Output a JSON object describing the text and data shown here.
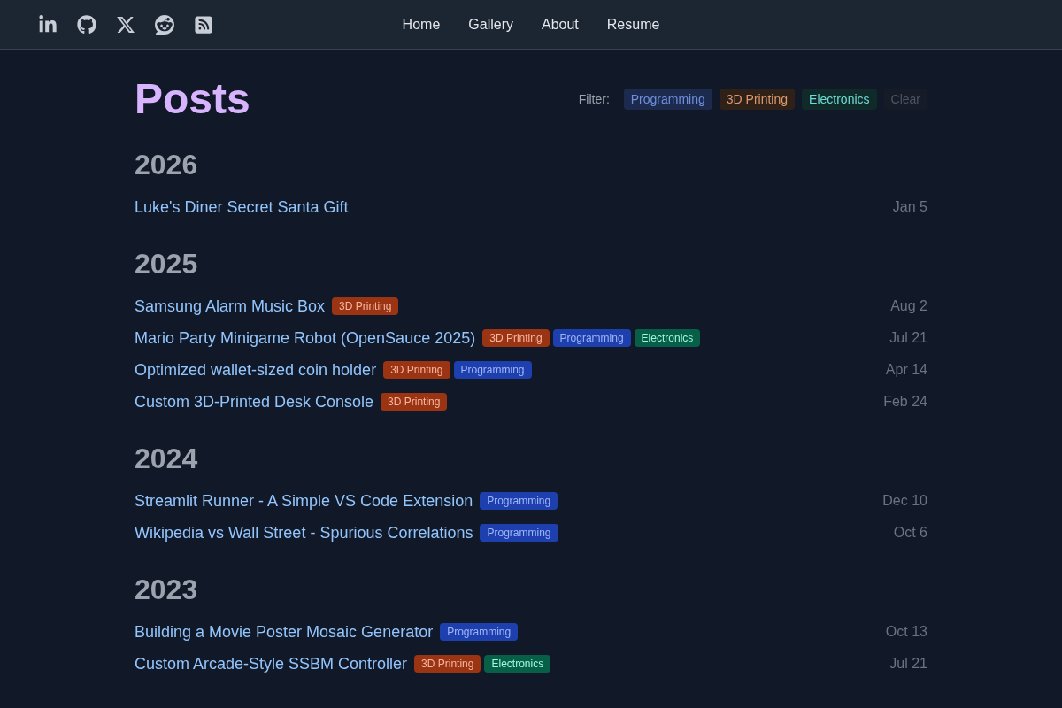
{
  "header": {
    "nav": [
      "Home",
      "Gallery",
      "About",
      "Resume"
    ]
  },
  "page": {
    "title": "Posts",
    "filter": {
      "label": "Filter:",
      "chips": [
        {
          "label": "Programming",
          "color": "#1c2a4e",
          "selected": false
        },
        {
          "label": "3D Printing",
          "color": "#2f2118",
          "selected": false
        },
        {
          "label": "Electronics",
          "color": "#0f2a28",
          "selected": false
        }
      ],
      "clear": "Clear"
    }
  },
  "sections": [
    {
      "year": "2026",
      "posts": [
        {
          "title": "Luke's Diner Secret Santa Gift",
          "date": "Jan 5"
        }
      ]
    },
    {
      "year": "2025",
      "posts": [
        {
          "title": "Samsung Alarm Music Box",
          "tags": [
            {
              "label": "3D Printing",
              "color": "#9a3412"
            }
          ],
          "date": "Aug 2"
        },
        {
          "title": "Mario Party Minigame Robot (OpenSauce 2025)",
          "tags": [
            {
              "label": "3D Printing",
              "color": "#9a3412"
            },
            {
              "label": "Programming",
              "color": "#1e40af"
            },
            {
              "label": "Electronics",
              "color": "#065f46"
            }
          ],
          "date": "Jul 21"
        },
        {
          "title": "Optimized wallet-sized coin holder",
          "tags": [
            {
              "label": "3D Printing",
              "color": "#9a3412"
            },
            {
              "label": "Programming",
              "color": "#1e40af"
            }
          ],
          "date": "Apr 14"
        },
        {
          "title": "Custom 3D-Printed Desk Console",
          "tags": [
            {
              "label": "3D Printing",
              "color": "#9a3412"
            }
          ],
          "date": "Feb 24"
        }
      ]
    },
    {
      "year": "2024",
      "posts": [
        {
          "title": "Streamlit Runner - A Simple VS Code Extension",
          "tags": [
            {
              "label": "Programming",
              "color": "#1e40af"
            }
          ],
          "date": "Dec 10"
        },
        {
          "title": "Wikipedia vs Wall Street - Spurious Correlations",
          "tags": [
            {
              "label": "Programming",
              "color": "#1e40af"
            }
          ],
          "date": "Oct 6"
        }
      ]
    },
    {
      "year": "2023",
      "posts": [
        {
          "title": "Building a Movie Poster Mosaic Generator",
          "tags": [
            {
              "label": "Programming",
              "color": "#1e40af"
            }
          ],
          "date": "Oct 13"
        },
        {
          "title": "Custom Arcade-Style SSBM Controller",
          "tags": [
            {
              "label": "3D Printing",
              "color": "#9a3412"
            },
            {
              "label": "Electronics",
              "color": "#065f46"
            }
          ],
          "date": "Jul 21"
        }
      ]
    }
  ]
}
